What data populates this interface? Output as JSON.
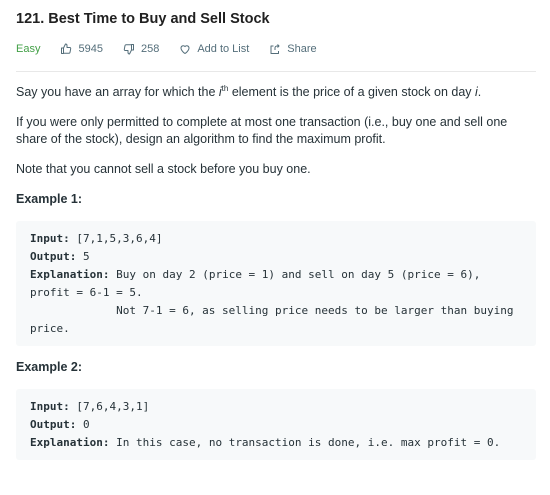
{
  "problem": {
    "title": "121. Best Time to Buy and Sell Stock",
    "difficulty": "Easy",
    "likes": "5945",
    "dislikes": "258",
    "add_to_list": "Add to List",
    "share": "Share"
  },
  "description": {
    "p1_before": "Say you have an array for which the ",
    "p1_i": "i",
    "p1_sup": "th",
    "p1_middle": " element is the price of a given stock on day ",
    "p1_i2": "i",
    "p1_end": ".",
    "p2": "If you were only permitted to complete at most one transaction (i.e., buy one and sell one share of the stock), design an algorithm to find the maximum profit.",
    "p3": "Note that you cannot sell a stock before you buy one."
  },
  "examples": [
    {
      "heading": "Example 1:",
      "input_label": "Input:",
      "input_value": " [7,1,5,3,6,4]",
      "output_label": "Output:",
      "output_value": " 5",
      "explanation_label": "Explanation:",
      "explanation_value": " Buy on day 2 (price = 1) and sell on day 5 (price = 6), profit = 6-1 = 5.\n             Not 7-1 = 6, as selling price needs to be larger than buying price."
    },
    {
      "heading": "Example 2:",
      "input_label": "Input:",
      "input_value": " [7,6,4,3,1]",
      "output_label": "Output:",
      "output_value": " 0",
      "explanation_label": "Explanation:",
      "explanation_value": " In this case, no transaction is done, i.e. max profit = 0."
    }
  ],
  "colors": {
    "easy": "#43a047",
    "meta_text": "#546e7a",
    "code_bg": "#f7f9fa"
  },
  "icons": {
    "like": "thumbs-up-icon",
    "dislike": "thumbs-down-icon",
    "add_to_list": "heart-icon",
    "share": "share-icon"
  }
}
